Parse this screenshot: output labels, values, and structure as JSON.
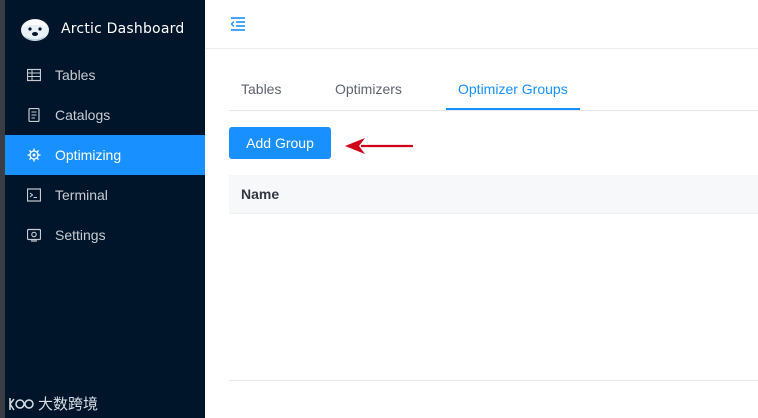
{
  "app": {
    "title": "Arctic Dashboard"
  },
  "sidebar": {
    "items": [
      {
        "label": "Tables",
        "icon": "table-icon",
        "active": false
      },
      {
        "label": "Catalogs",
        "icon": "catalog-icon",
        "active": false
      },
      {
        "label": "Optimizing",
        "icon": "optimizing-gear-icon",
        "active": true
      },
      {
        "label": "Terminal",
        "icon": "terminal-icon",
        "active": false
      },
      {
        "label": "Settings",
        "icon": "settings-icon",
        "active": false
      }
    ]
  },
  "watermark": {
    "text": "大数跨境"
  },
  "main": {
    "tabs": [
      {
        "label": "Tables",
        "active": false
      },
      {
        "label": "Optimizers",
        "active": false
      },
      {
        "label": "Optimizer Groups",
        "active": true
      }
    ],
    "add_group_label": "Add Group",
    "table": {
      "columns": [
        "Name"
      ],
      "rows": []
    }
  },
  "colors": {
    "sidebar_bg": "#00152a",
    "accent": "#1890ff",
    "arrow": "#d0021b"
  }
}
